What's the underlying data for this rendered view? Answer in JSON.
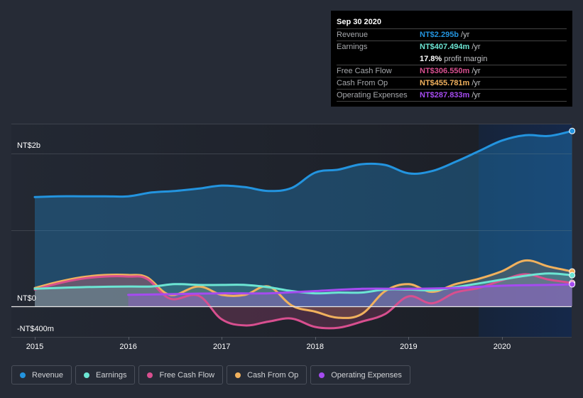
{
  "tooltip": {
    "date": "Sep 30 2020",
    "rows": [
      {
        "label": "Revenue",
        "value": "NT$2.295b",
        "unit": "/yr",
        "color": "#2394df"
      },
      {
        "label": "Earnings",
        "value": "NT$407.494m",
        "unit": "/yr",
        "color": "#6ce5d3"
      },
      {
        "label": "",
        "value": "17.8%",
        "unit": "profit margin",
        "color": "#ffffff"
      },
      {
        "label": "Free Cash Flow",
        "value": "NT$306.550m",
        "unit": "/yr",
        "color": "#d84f8f"
      },
      {
        "label": "Cash From Op",
        "value": "NT$455.781m",
        "unit": "/yr",
        "color": "#f1b15d"
      },
      {
        "label": "Operating Expenses",
        "value": "NT$287.833m",
        "unit": "/yr",
        "color": "#a54bf0"
      }
    ]
  },
  "legend": [
    {
      "label": "Revenue",
      "color": "#2394df"
    },
    {
      "label": "Earnings",
      "color": "#6ce5d3"
    },
    {
      "label": "Free Cash Flow",
      "color": "#d84f8f"
    },
    {
      "label": "Cash From Op",
      "color": "#f1b15d"
    },
    {
      "label": "Operating Expenses",
      "color": "#a54bf0"
    }
  ],
  "chart_data": {
    "type": "area",
    "title": "",
    "xlabel": "",
    "ylabel": "",
    "y_unit": "NT$ billions",
    "ylim": [
      -0.4,
      2.39
    ],
    "xlim": [
      2014.9,
      2020.75
    ],
    "y_ticks": [
      {
        "value": 2.0,
        "label": "NT$2b"
      },
      {
        "value": 0,
        "label": "NT$0"
      },
      {
        "value": -0.4,
        "label": "-NT$400m"
      }
    ],
    "x_ticks": [
      {
        "value": 2015,
        "label": "2015"
      },
      {
        "value": 2016,
        "label": "2016"
      },
      {
        "value": 2017,
        "label": "2017"
      },
      {
        "value": 2018,
        "label": "2018"
      },
      {
        "value": 2019,
        "label": "2019"
      },
      {
        "value": 2020,
        "label": "2020"
      }
    ],
    "highlight_from": 2019.75,
    "grid": true,
    "legend_position": "bottom-left",
    "series": [
      {
        "name": "Revenue",
        "color": "#2394df",
        "x": [
          2015.0,
          2015.25,
          2015.5,
          2015.75,
          2016.0,
          2016.25,
          2016.5,
          2016.75,
          2017.0,
          2017.25,
          2017.5,
          2017.75,
          2018.0,
          2018.25,
          2018.5,
          2018.75,
          2019.0,
          2019.25,
          2019.5,
          2019.75,
          2020.0,
          2020.25,
          2020.5,
          2020.75
        ],
        "values": [
          1.43,
          1.44,
          1.44,
          1.44,
          1.44,
          1.49,
          1.51,
          1.54,
          1.58,
          1.56,
          1.51,
          1.55,
          1.75,
          1.79,
          1.86,
          1.85,
          1.74,
          1.77,
          1.89,
          2.03,
          2.17,
          2.24,
          2.23,
          2.295
        ]
      },
      {
        "name": "Earnings",
        "color": "#6ce5d3",
        "x": [
          2015.0,
          2015.5,
          2016.0,
          2016.25,
          2016.5,
          2016.75,
          2017.0,
          2017.25,
          2017.5,
          2017.75,
          2018.0,
          2018.25,
          2018.5,
          2018.75,
          2019.0,
          2019.25,
          2019.5,
          2019.75,
          2020.0,
          2020.25,
          2020.5,
          2020.75
        ],
        "values": [
          0.23,
          0.25,
          0.26,
          0.26,
          0.29,
          0.28,
          0.28,
          0.28,
          0.25,
          0.2,
          0.17,
          0.18,
          0.18,
          0.22,
          0.22,
          0.21,
          0.25,
          0.3,
          0.35,
          0.4,
          0.43,
          0.407
        ]
      },
      {
        "name": "Free Cash Flow",
        "color": "#d84f8f",
        "x": [
          2015.0,
          2015.25,
          2015.5,
          2015.75,
          2016.0,
          2016.2,
          2016.45,
          2016.75,
          2017.0,
          2017.25,
          2017.5,
          2017.75,
          2018.0,
          2018.25,
          2018.5,
          2018.75,
          2019.0,
          2019.25,
          2019.5,
          2019.75,
          2020.0,
          2020.25,
          2020.5,
          2020.75
        ],
        "values": [
          0.22,
          0.3,
          0.36,
          0.39,
          0.39,
          0.36,
          0.1,
          0.14,
          -0.17,
          -0.25,
          -0.2,
          -0.16,
          -0.27,
          -0.28,
          -0.2,
          -0.1,
          0.13,
          0.04,
          0.18,
          0.24,
          0.34,
          0.42,
          0.35,
          0.307
        ]
      },
      {
        "name": "Cash From Op",
        "color": "#f1b15d",
        "x": [
          2015.0,
          2015.25,
          2015.5,
          2015.75,
          2016.0,
          2016.2,
          2016.45,
          2016.75,
          2017.0,
          2017.25,
          2017.5,
          2017.75,
          2018.0,
          2018.25,
          2018.5,
          2018.75,
          2019.0,
          2019.25,
          2019.5,
          2019.75,
          2020.0,
          2020.25,
          2020.5,
          2020.75
        ],
        "values": [
          0.24,
          0.32,
          0.38,
          0.41,
          0.41,
          0.38,
          0.15,
          0.26,
          0.15,
          0.15,
          0.26,
          0.01,
          -0.07,
          -0.15,
          -0.1,
          0.2,
          0.29,
          0.19,
          0.29,
          0.36,
          0.46,
          0.6,
          0.52,
          0.456
        ]
      },
      {
        "name": "Operating Expenses",
        "color": "#a54bf0",
        "x": [
          2016.0,
          2016.5,
          2017.0,
          2017.5,
          2018.0,
          2018.5,
          2019.0,
          2019.5,
          2020.0,
          2020.5,
          2020.75
        ],
        "values": [
          0.15,
          0.16,
          0.17,
          0.17,
          0.2,
          0.23,
          0.23,
          0.24,
          0.27,
          0.28,
          0.288
        ]
      }
    ]
  }
}
